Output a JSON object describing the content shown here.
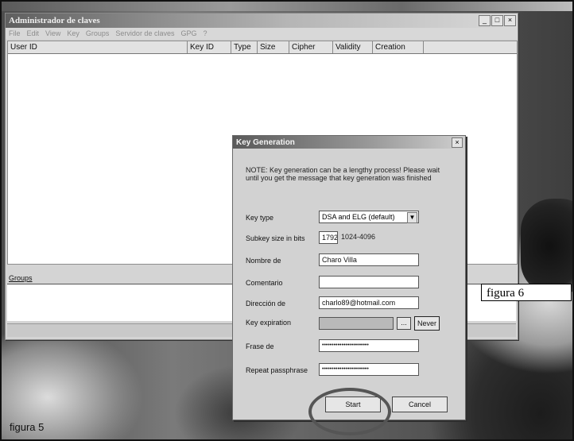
{
  "main_window": {
    "title": "Administrador de claves",
    "min_glyph": "_",
    "max_glyph": "□",
    "close_glyph": "×",
    "menu": [
      "File",
      "Edit",
      "View",
      "Key",
      "Groups",
      "Servidor de claves",
      "GPG",
      "?"
    ],
    "columns": [
      "User ID",
      "Key ID",
      "Type",
      "Size",
      "Cipher",
      "Validity",
      "Creation"
    ],
    "groups_label": "Groups"
  },
  "dialog": {
    "title": "Key Generation",
    "close_glyph": "×",
    "note": "NOTE: Key generation can be a lengthy process! Please wait until you get the message that key generation was finished",
    "key_type_label": "Key type",
    "key_type_value": "DSA and ELG (default)",
    "subkey_label": "Subkey size in bits",
    "subkey_value": "1792",
    "subkey_range": "1024-4096",
    "name_label": "Nombre de",
    "name_value": "Charo Villa",
    "comment_label": "Comentario",
    "comment_value": "",
    "email_label": "Dirección de",
    "email_value": "charlo89@hotmail.com",
    "expiration_label": "Key expiration",
    "expiration_btn": "...",
    "never_label": "Never",
    "pass_label": "Frase de",
    "pass_value": "••••••••••••••••••••••••",
    "repeat_label": "Repeat passphrase",
    "repeat_value": "••••••••••••••••••••••••",
    "start_label": "Start",
    "cancel_label": "Cancel"
  },
  "captions": {
    "figura6": "figura 6",
    "figura5": "figura 5"
  }
}
